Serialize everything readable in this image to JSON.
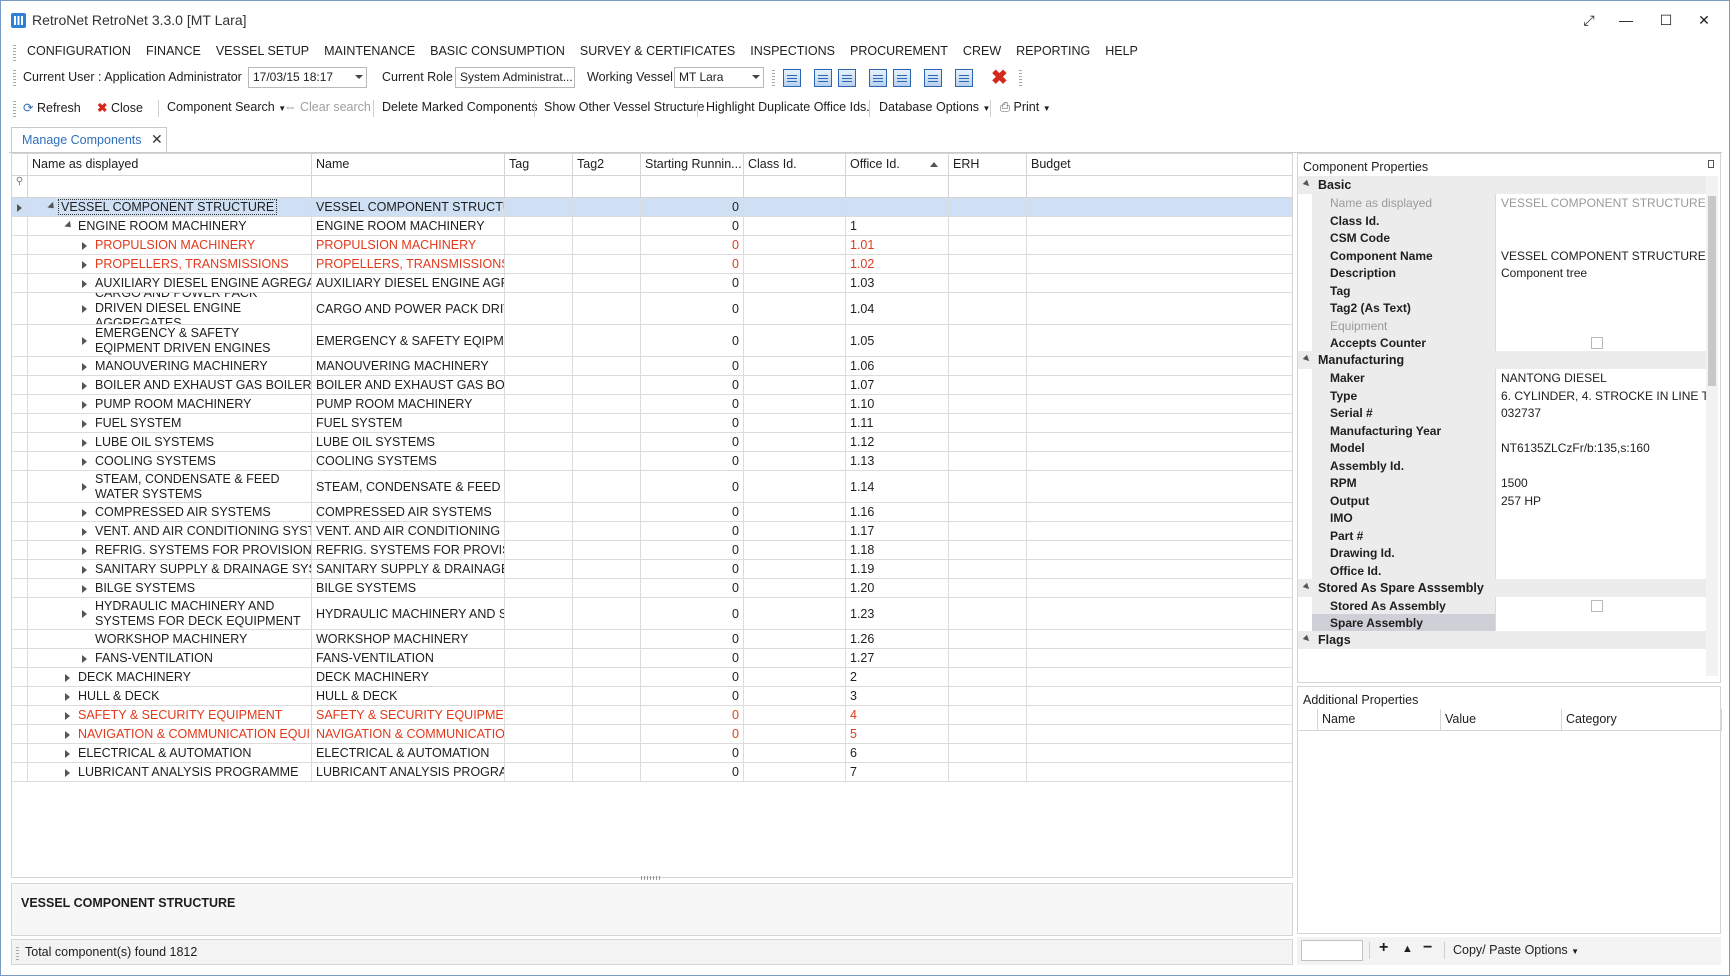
{
  "window": {
    "title": "RetroNet RetroNet 3.3.0 [MT Lara]",
    "controls": [
      "⤢",
      "—",
      "☐",
      "✕"
    ]
  },
  "menu": [
    "CONFIGURATION",
    "FINANCE",
    "VESSEL SETUP",
    "MAINTENANCE",
    "BASIC CONSUMPTION",
    "SURVEY & CERTIFICATES",
    "INSPECTIONS",
    "PROCUREMENT",
    "CREW",
    "REPORTING",
    "HELP"
  ],
  "toolbar1": {
    "current_user": "Current User : Application Administrator",
    "datetime": "17/03/15 18:17",
    "role_label": "Current Role",
    "role_value": "System Administrat...",
    "vessel_label": "Working Vessel",
    "vessel_value": "MT Lara"
  },
  "toolbar2": {
    "refresh": "Refresh",
    "close": "Close",
    "component_search": "Component Search",
    "clear_search": "Clear search",
    "delete_marked": "Delete Marked Components",
    "show_other": "Show Other Vessel Structure",
    "highlight_dup": "Highlight Duplicate Office Ids.",
    "db_options": "Database Options",
    "print": "Print"
  },
  "tab": {
    "label": "Manage Components",
    "close": "✕"
  },
  "grid": {
    "columns": [
      "Name as displayed",
      "Name",
      "Tag",
      "Tag2",
      "Starting Runnin...",
      "Class Id.",
      "Office Id.",
      "ERH",
      "Budget"
    ],
    "rows": [
      {
        "display": "VESSEL COMPONENT STRUCTURE",
        "name": "VESSEL COMPONENT STRUCTURE",
        "start": "0",
        "office": "",
        "level": 0,
        "state": "collapse",
        "red": false,
        "sel": true
      },
      {
        "display": "ENGINE ROOM MACHINERY",
        "name": "ENGINE ROOM MACHINERY",
        "start": "0",
        "office": "1",
        "level": 1,
        "state": "collapse",
        "red": false
      },
      {
        "display": "PROPULSION MACHINERY",
        "name": "PROPULSION MACHINERY",
        "start": "0",
        "office": "1.01",
        "level": 2,
        "state": "expand",
        "red": true
      },
      {
        "display": "PROPELLERS, TRANSMISSIONS",
        "name": "PROPELLERS, TRANSMISSIONS",
        "start": "0",
        "office": "1.02",
        "level": 2,
        "state": "expand",
        "red": true
      },
      {
        "display": "AUXILIARY DIESEL ENGINE AGREGATES",
        "name": "AUXILIARY DIESEL ENGINE AGREGATES",
        "start": "0",
        "office": "1.03",
        "level": 2,
        "state": "expand",
        "red": false
      },
      {
        "display": "CARGO AND POWER PACK DRIVEN DIESEL ENGINE AGGREGATES",
        "name": "CARGO AND POWER PACK DRIVEN D...",
        "start": "0",
        "office": "1.04",
        "level": 2,
        "state": "expand",
        "red": false,
        "tall": true
      },
      {
        "display": "EMERGENCY & SAFETY EQIPMENT DRIVEN ENGINES",
        "name": "EMERGENCY & SAFETY EQIPMENT D...",
        "start": "0",
        "office": "1.05",
        "level": 2,
        "state": "expand",
        "red": false,
        "tall": true
      },
      {
        "display": "MANOUVERING MACHINERY",
        "name": "MANOUVERING MACHINERY",
        "start": "0",
        "office": "1.06",
        "level": 2,
        "state": "expand",
        "red": false
      },
      {
        "display": "BOILER AND EXHAUST GAS BOILER (EGB)",
        "name": "BOILER AND EXHAUST GAS BOILER (...",
        "start": "0",
        "office": "1.07",
        "level": 2,
        "state": "expand",
        "red": false
      },
      {
        "display": "PUMP ROOM MACHINERY",
        "name": "PUMP ROOM MACHINERY",
        "start": "0",
        "office": "1.10",
        "level": 2,
        "state": "expand",
        "red": false
      },
      {
        "display": "FUEL SYSTEM",
        "name": "FUEL SYSTEM",
        "start": "0",
        "office": "1.11",
        "level": 2,
        "state": "expand",
        "red": false
      },
      {
        "display": "LUBE OIL SYSTEMS",
        "name": "LUBE OIL SYSTEMS",
        "start": "0",
        "office": "1.12",
        "level": 2,
        "state": "expand",
        "red": false
      },
      {
        "display": "COOLING SYSTEMS",
        "name": "COOLING SYSTEMS",
        "start": "0",
        "office": "1.13",
        "level": 2,
        "state": "expand",
        "red": false
      },
      {
        "display": "STEAM, CONDENSATE & FEED WATER SYSTEMS",
        "name": "STEAM, CONDENSATE & FEED WATE...",
        "start": "0",
        "office": "1.14",
        "level": 2,
        "state": "expand",
        "red": false,
        "tall": true
      },
      {
        "display": "COMPRESSED AIR SYSTEMS",
        "name": "COMPRESSED AIR SYSTEMS",
        "start": "0",
        "office": "1.16",
        "level": 2,
        "state": "expand",
        "red": false
      },
      {
        "display": "VENT. AND AIR CONDITIONING SYSTEMS",
        "name": "VENT. AND AIR CONDITIONING SYST...",
        "start": "0",
        "office": "1.17",
        "level": 2,
        "state": "expand",
        "red": false
      },
      {
        "display": "REFRIG. SYSTEMS FOR PROVISION",
        "name": "REFRIG. SYSTEMS FOR PROVISION",
        "start": "0",
        "office": "1.18",
        "level": 2,
        "state": "expand",
        "red": false
      },
      {
        "display": "SANITARY SUPPLY & DRAINAGE SYSTEMS",
        "name": "SANITARY SUPPLY & DRAINAGE SYS...",
        "start": "0",
        "office": "1.19",
        "level": 2,
        "state": "expand",
        "red": false
      },
      {
        "display": "BILGE SYSTEMS",
        "name": "BILGE SYSTEMS",
        "start": "0",
        "office": "1.20",
        "level": 2,
        "state": "expand",
        "red": false
      },
      {
        "display": "HYDRAULIC MACHINERY AND SYSTEMS FOR DECK EQUIPMENT",
        "name": "HYDRAULIC MACHINERY AND SYSTE...",
        "start": "0",
        "office": "1.23",
        "level": 2,
        "state": "expand",
        "red": false,
        "tall": true
      },
      {
        "display": "WORKSHOP MACHINERY",
        "name": "WORKSHOP MACHINERY",
        "start": "0",
        "office": "1.26",
        "level": 2,
        "state": "none",
        "red": false
      },
      {
        "display": "FANS-VENTILATION",
        "name": "FANS-VENTILATION",
        "start": "0",
        "office": "1.27",
        "level": 2,
        "state": "expand",
        "red": false
      },
      {
        "display": "DECK MACHINERY",
        "name": "DECK MACHINERY",
        "start": "0",
        "office": "2",
        "level": 1,
        "state": "expand",
        "red": false
      },
      {
        "display": "HULL & DECK",
        "name": "HULL & DECK",
        "start": "0",
        "office": "3",
        "level": 1,
        "state": "expand",
        "red": false
      },
      {
        "display": "SAFETY & SECURITY EQUIPMENT",
        "name": "SAFETY & SECURITY EQUIPMENT",
        "start": "0",
        "office": "4",
        "level": 1,
        "state": "expand",
        "red": true
      },
      {
        "display": "NAVIGATION & COMMUNICATION EQUIPMENT",
        "name": "NAVIGATION & COMMUNICATION ...",
        "start": "0",
        "office": "5",
        "level": 1,
        "state": "expand",
        "red": true
      },
      {
        "display": "ELECTRICAL & AUTOMATION",
        "name": "ELECTRICAL & AUTOMATION",
        "start": "0",
        "office": "6",
        "level": 1,
        "state": "expand",
        "red": false
      },
      {
        "display": "LUBRICANT ANALYSIS PROGRAMME",
        "name": "LUBRICANT ANALYSIS PROGRAMME",
        "start": "0",
        "office": "7",
        "level": 1,
        "state": "expand",
        "red": false
      }
    ]
  },
  "selected_component": "VESSEL COMPONENT STRUCTURE",
  "status": "Total component(s) found 1812",
  "properties": {
    "title": "Component Properties",
    "groups": [
      {
        "name": "Basic",
        "rows": [
          {
            "name": "Name as displayed",
            "value": "VESSEL COMPONENT STRUCTURE",
            "disabled": true
          },
          {
            "name": "Class Id.",
            "value": ""
          },
          {
            "name": "CSM Code",
            "value": ""
          },
          {
            "name": "Component Name",
            "value": "VESSEL COMPONENT STRUCTURE"
          },
          {
            "name": "Description",
            "value": "Component tree"
          },
          {
            "name": "Tag",
            "value": ""
          },
          {
            "name": "Tag2 (As Text)",
            "value": ""
          },
          {
            "name": "Equipment",
            "value": "",
            "disabled": true
          },
          {
            "name": "Accepts Counter",
            "value": "",
            "check": true
          }
        ]
      },
      {
        "name": "Manufacturing",
        "rows": [
          {
            "name": "Maker",
            "value": "NANTONG DIESEL"
          },
          {
            "name": "Type",
            "value": "6. CYLINDER, 4. STROCKE IN LINE T..."
          },
          {
            "name": "Serial #",
            "value": "032737"
          },
          {
            "name": "Manufacturing Year",
            "value": ""
          },
          {
            "name": "Model",
            "value": "NT6135ZLCzFr/b:135,s:160"
          },
          {
            "name": "Assembly Id.",
            "value": ""
          },
          {
            "name": "RPM",
            "value": "1500"
          },
          {
            "name": "Output",
            "value": "257 HP"
          },
          {
            "name": "IMO",
            "value": ""
          },
          {
            "name": "Part #",
            "value": ""
          },
          {
            "name": "Drawing Id.",
            "value": ""
          },
          {
            "name": "Office Id.",
            "value": ""
          }
        ]
      },
      {
        "name": "Stored As Spare Asssembly",
        "rows": [
          {
            "name": "Stored As Assembly",
            "value": "",
            "check": true
          },
          {
            "name": "Spare Assembly",
            "value": "",
            "selected": true
          }
        ]
      },
      {
        "name": "Flags",
        "rows": []
      }
    ]
  },
  "additional": {
    "title": "Additional Properties",
    "columns": [
      "Name",
      "Value",
      "Category"
    ],
    "copy_paste": "Copy/ Paste Options"
  }
}
